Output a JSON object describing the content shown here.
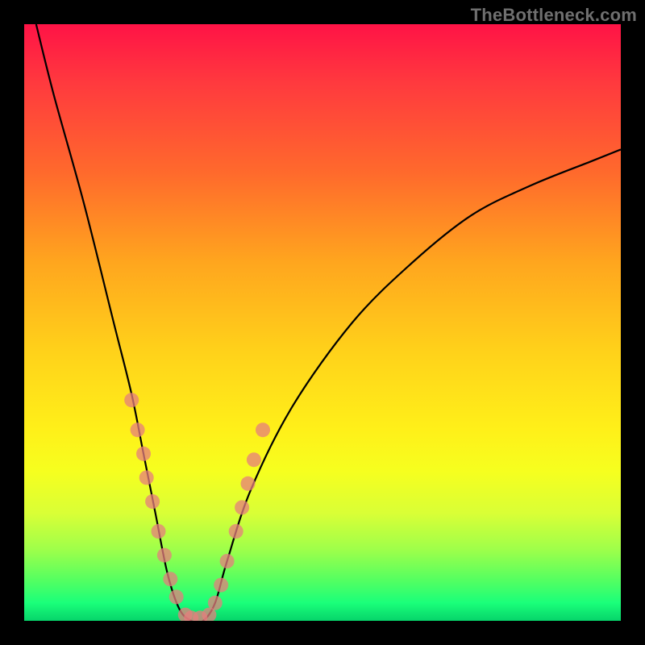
{
  "watermark": "TheBottleneck.com",
  "chart_data": {
    "type": "line",
    "title": "",
    "xlabel": "",
    "ylabel": "",
    "xlim": [
      0,
      100
    ],
    "ylim": [
      0,
      100
    ],
    "background_gradient": [
      "#ff1346",
      "#ff3a3e",
      "#ff6a2c",
      "#ffa61e",
      "#ffd21a",
      "#fff019",
      "#f6ff1f",
      "#d9ff36",
      "#9fff4a",
      "#57ff60",
      "#1aff7a",
      "#06d46a"
    ],
    "series": [
      {
        "name": "bottleneck-curve",
        "x": [
          2,
          5,
          10,
          15,
          18,
          20,
          22,
          24,
          26,
          28,
          30,
          32,
          34,
          38,
          45,
          55,
          65,
          75,
          85,
          95,
          100
        ],
        "y": [
          100,
          88,
          70,
          50,
          38,
          28,
          18,
          8,
          2,
          0,
          0,
          3,
          10,
          22,
          36,
          50,
          60,
          68,
          73,
          77,
          79
        ]
      }
    ],
    "highlight_points": {
      "name": "reference-dots",
      "color": "#e67d7d",
      "points": [
        {
          "x": 18,
          "y": 37
        },
        {
          "x": 19,
          "y": 32
        },
        {
          "x": 20,
          "y": 28
        },
        {
          "x": 20.5,
          "y": 24
        },
        {
          "x": 21.5,
          "y": 20
        },
        {
          "x": 22.5,
          "y": 15
        },
        {
          "x": 23.5,
          "y": 11
        },
        {
          "x": 24.5,
          "y": 7
        },
        {
          "x": 25.5,
          "y": 4
        },
        {
          "x": 27,
          "y": 1
        },
        {
          "x": 28,
          "y": 0.5
        },
        {
          "x": 29.5,
          "y": 0.5
        },
        {
          "x": 31,
          "y": 1
        },
        {
          "x": 32,
          "y": 3
        },
        {
          "x": 33,
          "y": 6
        },
        {
          "x": 34,
          "y": 10
        },
        {
          "x": 35.5,
          "y": 15
        },
        {
          "x": 36.5,
          "y": 19
        },
        {
          "x": 37.5,
          "y": 23
        },
        {
          "x": 38.5,
          "y": 27
        },
        {
          "x": 40,
          "y": 32
        }
      ]
    }
  }
}
